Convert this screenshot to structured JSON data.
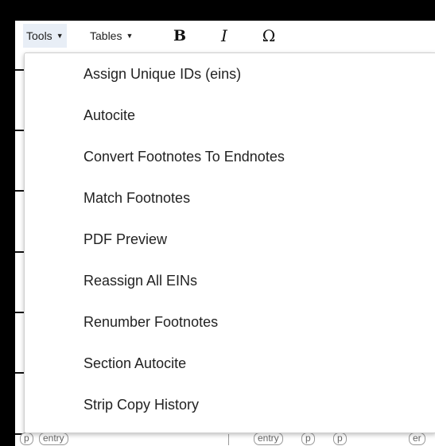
{
  "toolbar": {
    "tools_label": "Tools",
    "tables_label": "Tables",
    "bold_label": "B",
    "italic_label": "I",
    "special_char_label": "Ω",
    "caret": "▼"
  },
  "tools_menu": {
    "items": [
      {
        "label": "Assign Unique IDs (eins)"
      },
      {
        "label": "Autocite"
      },
      {
        "label": "Convert Footnotes To Endnotes"
      },
      {
        "label": "Match Footnotes"
      },
      {
        "label": "PDF Preview"
      },
      {
        "label": "Reassign All EINs"
      },
      {
        "label": "Renumber Footnotes"
      },
      {
        "label": "Section Autocite"
      },
      {
        "label": "Strip Copy History"
      }
    ]
  },
  "editor_tags": {
    "tag_p_1": "p",
    "tag_entry_1": "entry",
    "tag_entry_2": "entry",
    "tag_p_2": "p",
    "tag_p_3": "p",
    "tag_cutoff": "er"
  }
}
